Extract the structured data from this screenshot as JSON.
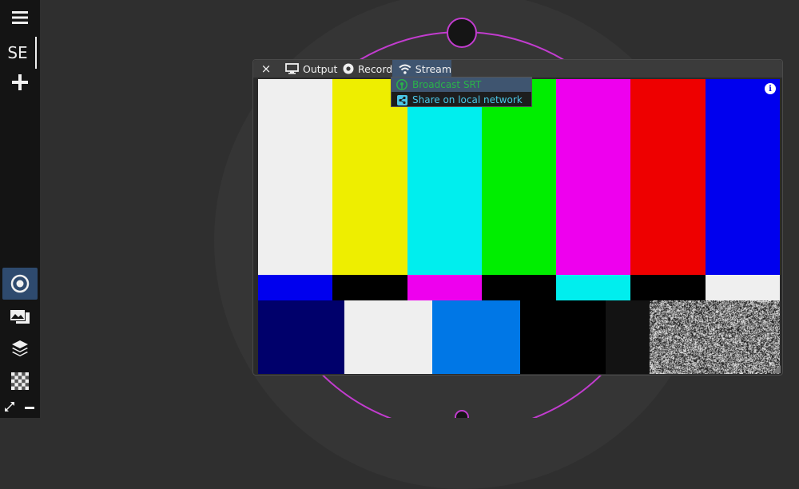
{
  "toolbar": {
    "session_label": "SE",
    "top_icons": [
      "menu-icon",
      "plus-icon"
    ],
    "bottom_icons": [
      "target-icon",
      "scene-icon",
      "layers-icon",
      "checkerboard-icon",
      "expand-icon",
      "minus-icon"
    ]
  },
  "window": {
    "tabs": [
      {
        "label": "Output",
        "icon": "monitor-icon"
      },
      {
        "label": "Record",
        "icon": "record-icon"
      },
      {
        "label": "Stream",
        "icon": "wifi-icon",
        "active": true
      }
    ],
    "close_glyph": "×",
    "info_glyph": "i"
  },
  "stream_menu": {
    "items": [
      {
        "label": "Broadcast SRT",
        "icon": "broadcast-icon",
        "color": "#2ab34a",
        "highlighted": true
      },
      {
        "label": "Share on local network",
        "icon": "share-icon",
        "color": "#4bc6e6"
      }
    ]
  },
  "test_pattern": {
    "top_bars": [
      "#efefef",
      "#eeee00",
      "#00eeee",
      "#00ee00",
      "#ee00ee",
      "#ee0000",
      "#0000ee"
    ],
    "middle_bars": [
      "#0000ee",
      "#000000",
      "#ee00ee",
      "#000000",
      "#00eeee",
      "#000000",
      "#efefef"
    ],
    "bottom_bars": [
      "#00006b",
      "#efefef",
      "#0077e6",
      "#000000",
      "#131313",
      "noise"
    ]
  },
  "colors": {
    "accent": "#3f5570",
    "ring": "#c23ccf",
    "toolbar_bg": "#141414"
  }
}
